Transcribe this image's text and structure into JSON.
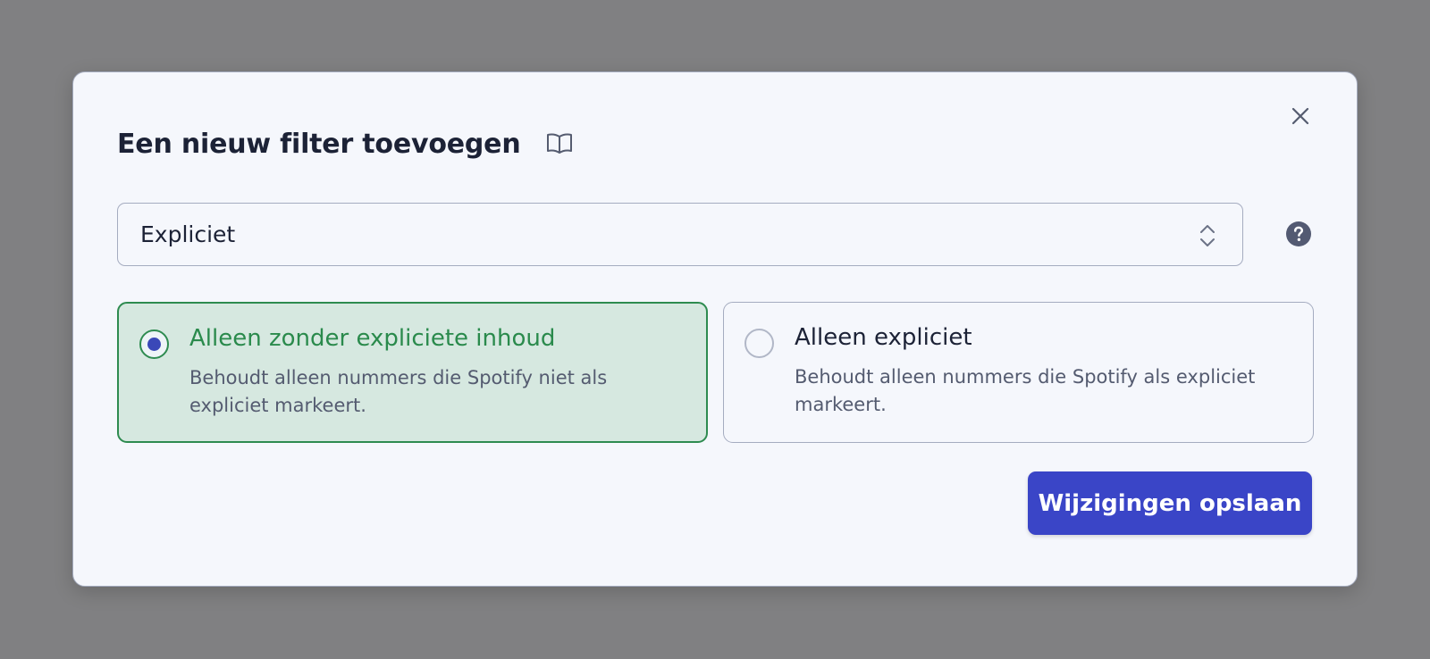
{
  "dialog": {
    "title": "Een nieuw filter toevoegen",
    "title_icon": "book-open-icon",
    "close_icon": "close-icon"
  },
  "filter_select": {
    "value": "Expliciet",
    "icon": "chevron-up-down-icon"
  },
  "help": {
    "icon": "question-circle-icon"
  },
  "options": [
    {
      "title": "Alleen zonder expliciete inhoud",
      "description": "Behoudt alleen nummers die Spotify niet als expliciet markeert.",
      "selected": true
    },
    {
      "title": "Alleen expliciet",
      "description": "Behoudt alleen nummers die Spotify als expliciet markeert.",
      "selected": false
    }
  ],
  "footer": {
    "save_label": "Wijzigingen opslaan"
  },
  "colors": {
    "overlay": "#808082",
    "dialog_bg": "#f5f7fc",
    "selected_bg": "#d6e8e0",
    "selected_accent": "#2e8b50",
    "primary_button": "#3a45c7"
  }
}
